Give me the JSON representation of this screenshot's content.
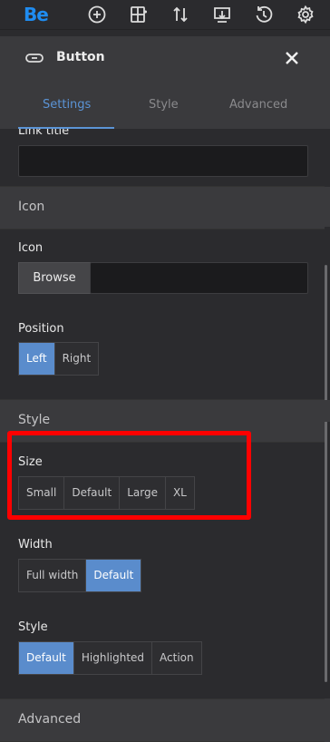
{
  "toolbar": {
    "logo": "Be",
    "icons": [
      "add-circle-icon",
      "layout-add-icon",
      "sort-arrows-icon",
      "download-tray-icon",
      "history-icon",
      "gear-icon"
    ]
  },
  "panel": {
    "title": "Button",
    "icon": "link-icon",
    "close_icon": "close-icon"
  },
  "tabs": [
    {
      "label": "Settings",
      "active": true
    },
    {
      "label": "Style",
      "active": false
    },
    {
      "label": "Advanced",
      "active": false
    }
  ],
  "fields": {
    "link_title_label": "Link title",
    "icon_section": "Icon",
    "icon_label": "Icon",
    "browse_label": "Browse",
    "position_label": "Position",
    "position_options": [
      "Left",
      "Right"
    ],
    "position_selected": "Left",
    "style_section": "Style",
    "size_label": "Size",
    "size_options": [
      "Small",
      "Default",
      "Large",
      "XL"
    ],
    "width_label": "Width",
    "width_options": [
      "Full width",
      "Default"
    ],
    "width_selected": "Default",
    "style_label": "Style",
    "style_options": [
      "Default",
      "Highlighted",
      "Action"
    ],
    "style_selected": "Default",
    "advanced_section": "Advanced"
  },
  "colors": {
    "accent": "#5a8ccc",
    "tab_active": "#5b94d6",
    "highlight": "#ff0000",
    "logo": "#1f8cf0"
  }
}
